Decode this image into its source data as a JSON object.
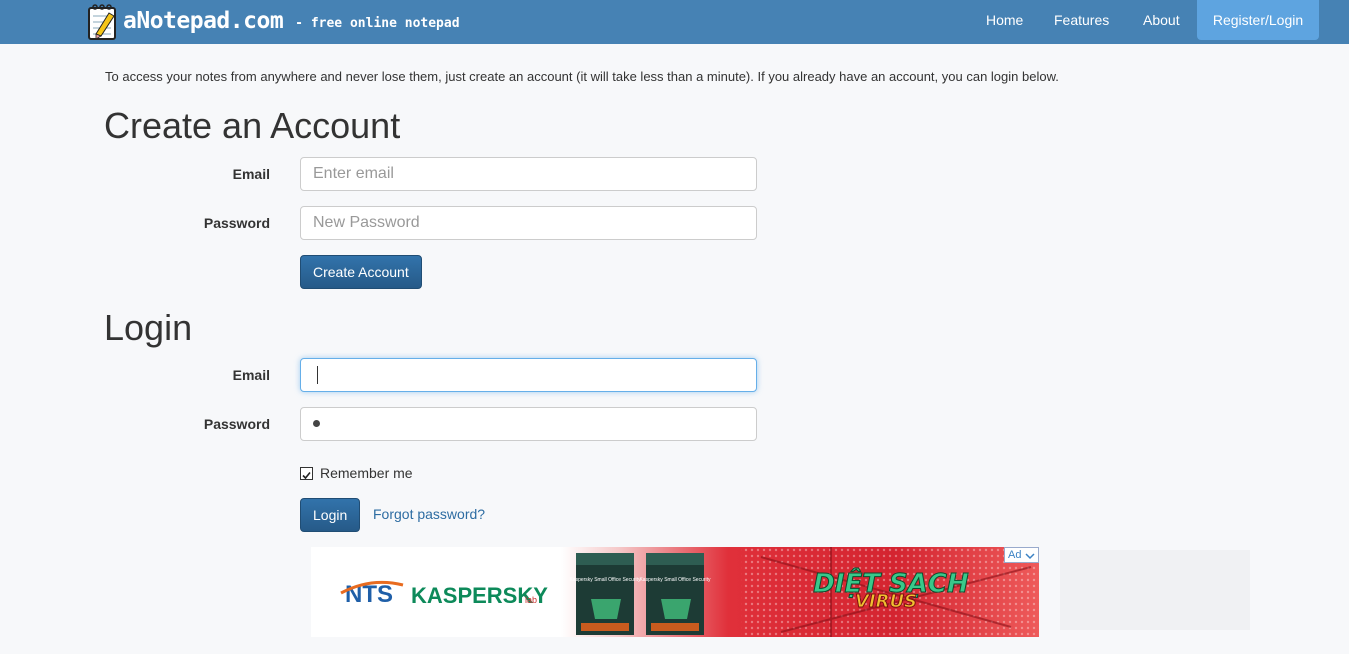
{
  "navbar": {
    "brand_name": "aNotepad.com",
    "tagline": "- free online notepad",
    "links": [
      {
        "label": "Home"
      },
      {
        "label": "Features"
      },
      {
        "label": "About"
      }
    ],
    "active_link": "Register/Login",
    "colors": {
      "bar": "#4682b4",
      "active": "#5ea4e0"
    }
  },
  "intro": "To access your notes from anywhere and never lose them, just create an account (it will take less than a minute). If you already have an account, you can login below.",
  "register": {
    "title": "Create an Account",
    "email_label": "Email",
    "email_placeholder": "Enter email",
    "password_label": "Password",
    "password_placeholder": "New Password",
    "submit_label": "Create Account"
  },
  "login": {
    "title": "Login",
    "email_label": "Email",
    "email_value": "",
    "password_label": "Password",
    "remember_label": "Remember me",
    "remember_checked": true,
    "submit_label": "Login",
    "forgot_label": "Forgot password?"
  },
  "ad": {
    "badge": "Ad",
    "brand_1": "NTS",
    "brand_2": "KASPERSKY",
    "brand_2_suffix": "lab",
    "product": "Kaspersky Small Office Security",
    "headline_1": "DIỆT SẠCH",
    "headline_2": "VIRUS"
  }
}
